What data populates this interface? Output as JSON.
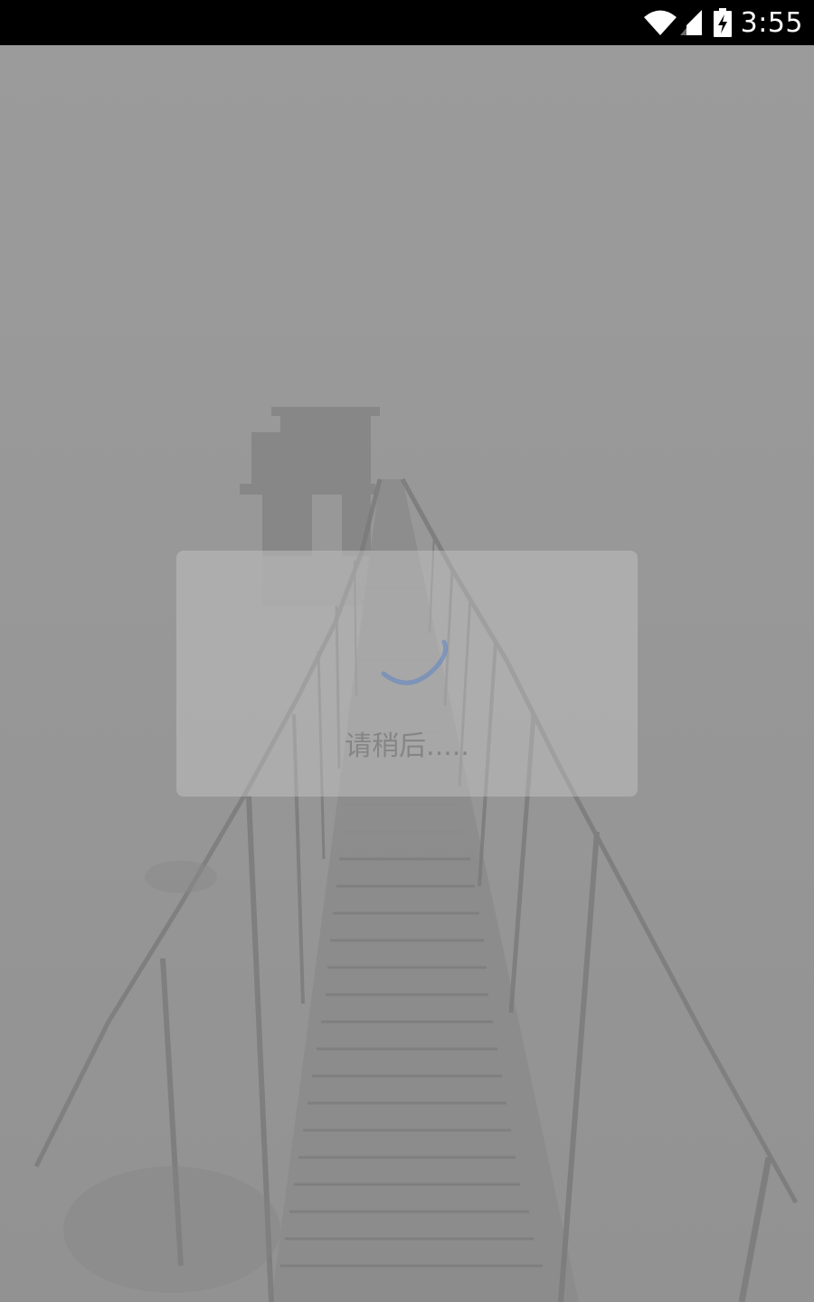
{
  "status_bar": {
    "time": "3:55",
    "icons": [
      "wifi-icon",
      "signal-icon",
      "battery-charging-icon"
    ]
  },
  "background": {
    "description_icon": "foggy-pier-photo"
  },
  "loading_dialog": {
    "message": "请稍后.....",
    "spinner_color": "#5b84c4"
  },
  "colors": {
    "status_bar_bg": "#000000",
    "overlay": "#9a9a9a",
    "dialog_bg": "#c8c8c8",
    "text": "#858585"
  }
}
